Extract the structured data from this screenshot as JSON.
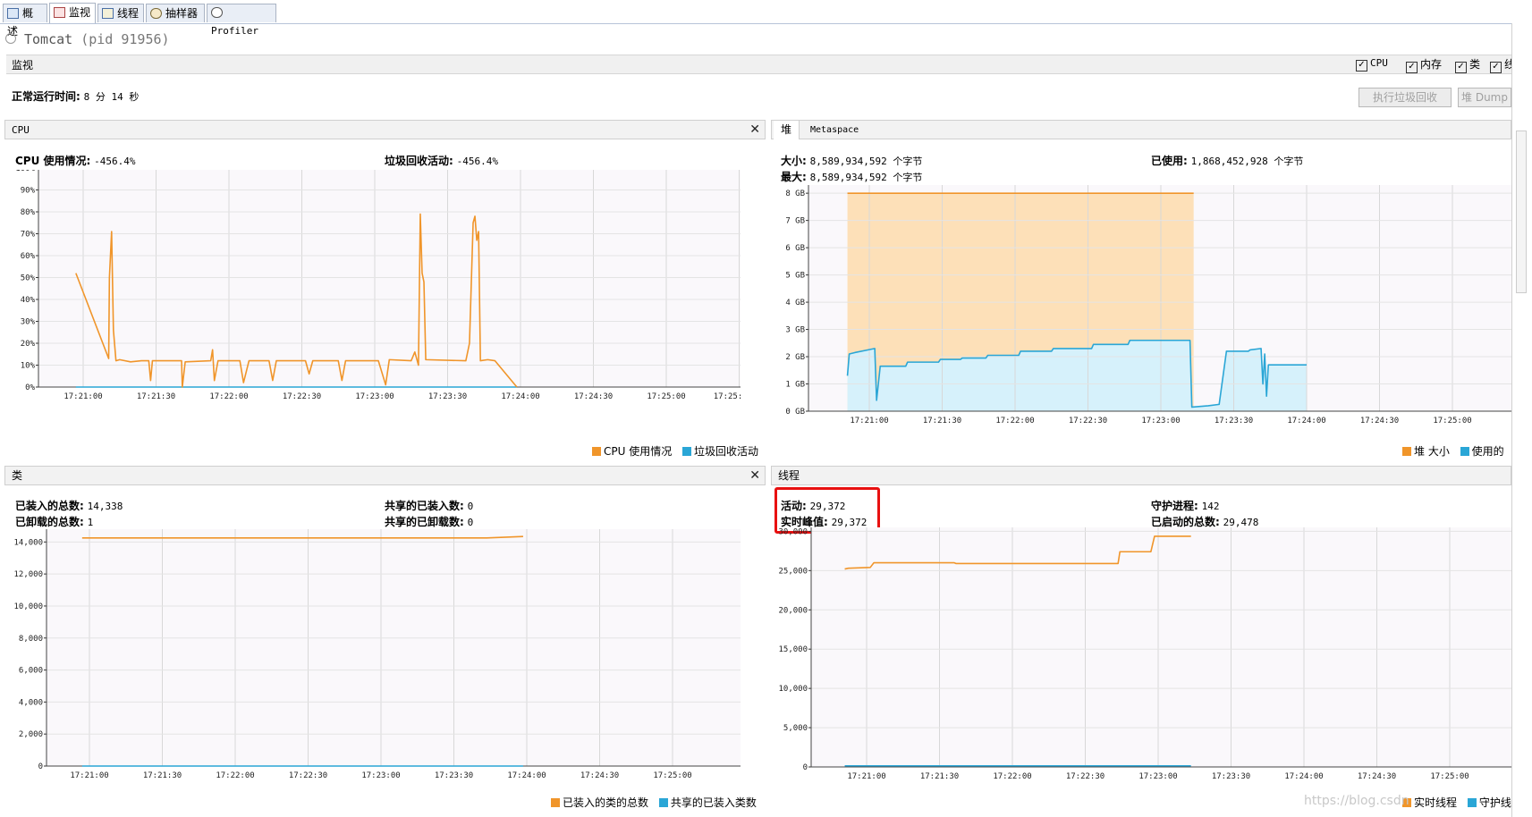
{
  "tabs": [
    {
      "label": "概述",
      "icon": "overview-icon"
    },
    {
      "label": "监视",
      "icon": "monitor-icon"
    },
    {
      "label": "线程",
      "icon": "threads-icon"
    },
    {
      "label": "抽样器",
      "icon": "sampler-icon"
    },
    {
      "label": "Profiler",
      "icon": "profiler-icon"
    }
  ],
  "app": {
    "title": "Tomcat",
    "pid": "(pid 91956)"
  },
  "monitor": {
    "section_label": "监视",
    "checkboxes": [
      {
        "label": "CPU",
        "checked": true
      },
      {
        "label": "内存",
        "checked": true
      },
      {
        "label": "类",
        "checked": true
      },
      {
        "label": "线",
        "checked": true
      }
    ],
    "uptime_label": "正常运行时间:",
    "uptime_value": "8 分 14 秒",
    "gc_button": "执行垃圾回收",
    "heap_dump_button": "堆 Dump"
  },
  "cpu": {
    "title": "CPU",
    "usage_label": "CPU 使用情况:",
    "usage_value": "-456.4%",
    "gc_label": "垃圾回收活动:",
    "gc_value": "-456.4%",
    "legend": [
      "CPU 使用情况",
      "垃圾回收活动"
    ]
  },
  "heap": {
    "tabs": [
      "堆",
      "Metaspace"
    ],
    "size_label": "大小:",
    "size_value": "8,589,934,592 个字节",
    "max_label": "最大:",
    "max_value": "8,589,934,592 个字节",
    "used_label": "已使用:",
    "used_value": "1,868,452,928 个字节",
    "legend": [
      "堆 大小",
      "使用的"
    ]
  },
  "classes": {
    "title": "类",
    "loaded_total_label": "已装入的总数:",
    "loaded_total_value": "14,338",
    "unloaded_total_label": "已卸载的总数:",
    "unloaded_total_value": "1",
    "shared_loaded_label": "共享的已装入数:",
    "shared_loaded_value": "0",
    "shared_unloaded_label": "共享的已卸载数:",
    "shared_unloaded_value": "0",
    "legend": [
      "已装入的类的总数",
      "共享的已装入类数"
    ]
  },
  "threads": {
    "title": "线程",
    "live_label": "活动:",
    "live_value": "29,372",
    "peak_label": "实时峰值:",
    "peak_value": "29,372",
    "daemon_label": "守护进程:",
    "daemon_value": "142",
    "started_label": "已启动的总数:",
    "started_value": "29,478",
    "legend": [
      "实时线程",
      "守护线"
    ]
  },
  "colors": {
    "orange": "#f0952a",
    "blue": "#2aa6d6",
    "highlight": "#e81010"
  },
  "watermark": "https://blog.csdn",
  "chart_data": [
    {
      "id": "cpu",
      "type": "line",
      "x_ticks": [
        "17:21:00",
        "17:21:30",
        "17:22:00",
        "17:22:30",
        "17:23:00",
        "17:23:30",
        "17:24:00",
        "17:24:30",
        "17:25:00",
        "17:25:"
      ],
      "y_ticks": [
        "0%",
        "10%",
        "20%",
        "30%",
        "40%",
        "50%",
        "60%",
        "70%",
        "80%",
        "90%",
        "100%"
      ],
      "ylim": [
        0,
        100
      ],
      "series": [
        {
          "name": "CPU 使用情况",
          "color": "#f0952a",
          "points": [
            [
              -0.2,
              52
            ],
            [
              0.7,
              13
            ],
            [
              0.72,
              50
            ],
            [
              0.78,
              71
            ],
            [
              0.83,
              26
            ],
            [
              0.9,
              12
            ],
            [
              1,
              12.5
            ],
            [
              1.3,
              11.5
            ],
            [
              1.6,
              12
            ],
            [
              1.8,
              12
            ],
            [
              1.85,
              3
            ],
            [
              1.9,
              12
            ],
            [
              2.4,
              12
            ],
            [
              2.7,
              12
            ],
            [
              2.72,
              0
            ],
            [
              2.8,
              11.5
            ],
            [
              3.5,
              12
            ],
            [
              3.55,
              17
            ],
            [
              3.6,
              3
            ],
            [
              3.7,
              12
            ],
            [
              4.3,
              12
            ],
            [
              4.4,
              2
            ],
            [
              4.55,
              12
            ],
            [
              5.1,
              12
            ],
            [
              5.2,
              3
            ],
            [
              5.3,
              12
            ],
            [
              6.1,
              12
            ],
            [
              6.2,
              6
            ],
            [
              6.3,
              12
            ],
            [
              7.0,
              12
            ],
            [
              7.1,
              3
            ],
            [
              7.2,
              12
            ],
            [
              8.1,
              12
            ],
            [
              8.3,
              1
            ],
            [
              8.4,
              12.5
            ],
            [
              9.0,
              12
            ],
            [
              9.1,
              16
            ],
            [
              9.2,
              10
            ],
            [
              9.25,
              79
            ],
            [
              9.3,
              52
            ],
            [
              9.35,
              48
            ],
            [
              9.4,
              12.5
            ],
            [
              10.5,
              12
            ],
            [
              10.6,
              20
            ],
            [
              10.7,
              75
            ],
            [
              10.75,
              78
            ],
            [
              10.8,
              67
            ],
            [
              10.85,
              71
            ],
            [
              10.9,
              12
            ],
            [
              11.1,
              12.5
            ],
            [
              11.3,
              12
            ],
            [
              11.9,
              0
            ]
          ]
        },
        {
          "name": "垃圾回收活动",
          "color": "#2aa6d6",
          "points": [
            [
              -0.2,
              0
            ],
            [
              11.9,
              0
            ]
          ]
        }
      ]
    },
    {
      "id": "heap",
      "type": "area",
      "x_ticks": [
        "17:21:00",
        "17:21:30",
        "17:22:00",
        "17:22:30",
        "17:23:00",
        "17:23:30",
        "17:24:00",
        "17:24:30",
        "17:25:00",
        "17:2"
      ],
      "y_ticks": [
        "0 GB",
        "1 GB",
        "2 GB",
        "3 GB",
        "4 GB",
        "5 GB",
        "6 GB",
        "7 GB",
        "8 GB"
      ],
      "ylim": [
        0,
        8.3
      ],
      "series": [
        {
          "name": "堆 大小",
          "color": "#f0952a",
          "points": [
            [
              -0.6,
              8
            ],
            [
              8.9,
              8
            ]
          ]
        },
        {
          "name": "使用的",
          "color": "#2aa6d6",
          "points": [
            [
              -0.6,
              1.3
            ],
            [
              -0.55,
              2.1
            ],
            [
              -0.4,
              2.15
            ],
            [
              0.15,
              2.3
            ],
            [
              0.2,
              0.4
            ],
            [
              0.3,
              1.65
            ],
            [
              1.0,
              1.65
            ],
            [
              1.05,
              1.8
            ],
            [
              1.9,
              1.8
            ],
            [
              1.95,
              1.9
            ],
            [
              2.5,
              1.9
            ],
            [
              2.55,
              1.95
            ],
            [
              3.2,
              1.95
            ],
            [
              3.25,
              2.05
            ],
            [
              4.1,
              2.05
            ],
            [
              4.15,
              2.2
            ],
            [
              5.0,
              2.2
            ],
            [
              5.05,
              2.3
            ],
            [
              6.1,
              2.3
            ],
            [
              6.15,
              2.45
            ],
            [
              7.1,
              2.45
            ],
            [
              7.15,
              2.6
            ],
            [
              8.8,
              2.6
            ],
            [
              8.85,
              0.15
            ],
            [
              9.3,
              0.2
            ],
            [
              9.6,
              0.25
            ],
            [
              9.8,
              2.2
            ],
            [
              10.4,
              2.2
            ],
            [
              10.45,
              2.25
            ],
            [
              10.75,
              2.3
            ],
            [
              10.8,
              1.0
            ],
            [
              10.85,
              2.1
            ],
            [
              10.9,
              0.55
            ],
            [
              10.95,
              1.7
            ],
            [
              12.0,
              1.7
            ]
          ]
        }
      ]
    },
    {
      "id": "classes",
      "type": "line",
      "x_ticks": [
        "17:21:00",
        "17:21:30",
        "17:22:00",
        "17:22:30",
        "17:23:00",
        "17:23:30",
        "17:24:00",
        "17:24:30",
        "17:25:00",
        "17:25:"
      ],
      "y_ticks": [
        "0",
        "2,000",
        "4,000",
        "6,000",
        "8,000",
        "10,000",
        "12,000",
        "14,000"
      ],
      "ylim": [
        0,
        14800
      ],
      "series": [
        {
          "name": "已装入的类的总数",
          "color": "#f0952a",
          "points": [
            [
              -0.2,
              14250
            ],
            [
              10.9,
              14250
            ],
            [
              11.9,
              14340
            ]
          ]
        },
        {
          "name": "共享的已装入类数",
          "color": "#2aa6d6",
          "points": [
            [
              -0.2,
              0
            ],
            [
              11.9,
              0
            ]
          ]
        }
      ]
    },
    {
      "id": "threads",
      "type": "line",
      "x_ticks": [
        "17:21:00",
        "17:21:30",
        "17:22:00",
        "17:22:30",
        "17:23:00",
        "17:23:30",
        "17:24:00",
        "17:24:30",
        "17:25:00",
        "17:2"
      ],
      "y_ticks": [
        "0",
        "5,000",
        "10,000",
        "15,000",
        "20,000",
        "25,000",
        "30,000"
      ],
      "ylim": [
        0,
        30500
      ],
      "series": [
        {
          "name": "实时线程",
          "color": "#f0952a",
          "points": [
            [
              -0.6,
              25200
            ],
            [
              -0.5,
              25300
            ],
            [
              0.1,
              25400
            ],
            [
              0.2,
              26000
            ],
            [
              2.4,
              26000
            ],
            [
              2.45,
              25900
            ],
            [
              6.9,
              25900
            ],
            [
              6.95,
              27400
            ],
            [
              7.8,
              27400
            ],
            [
              7.9,
              29372
            ],
            [
              8.9,
              29372
            ]
          ]
        },
        {
          "name": "守护线",
          "color": "#2aa6d6",
          "points": [
            [
              -0.6,
              142
            ],
            [
              8.9,
              142
            ]
          ]
        }
      ]
    }
  ]
}
